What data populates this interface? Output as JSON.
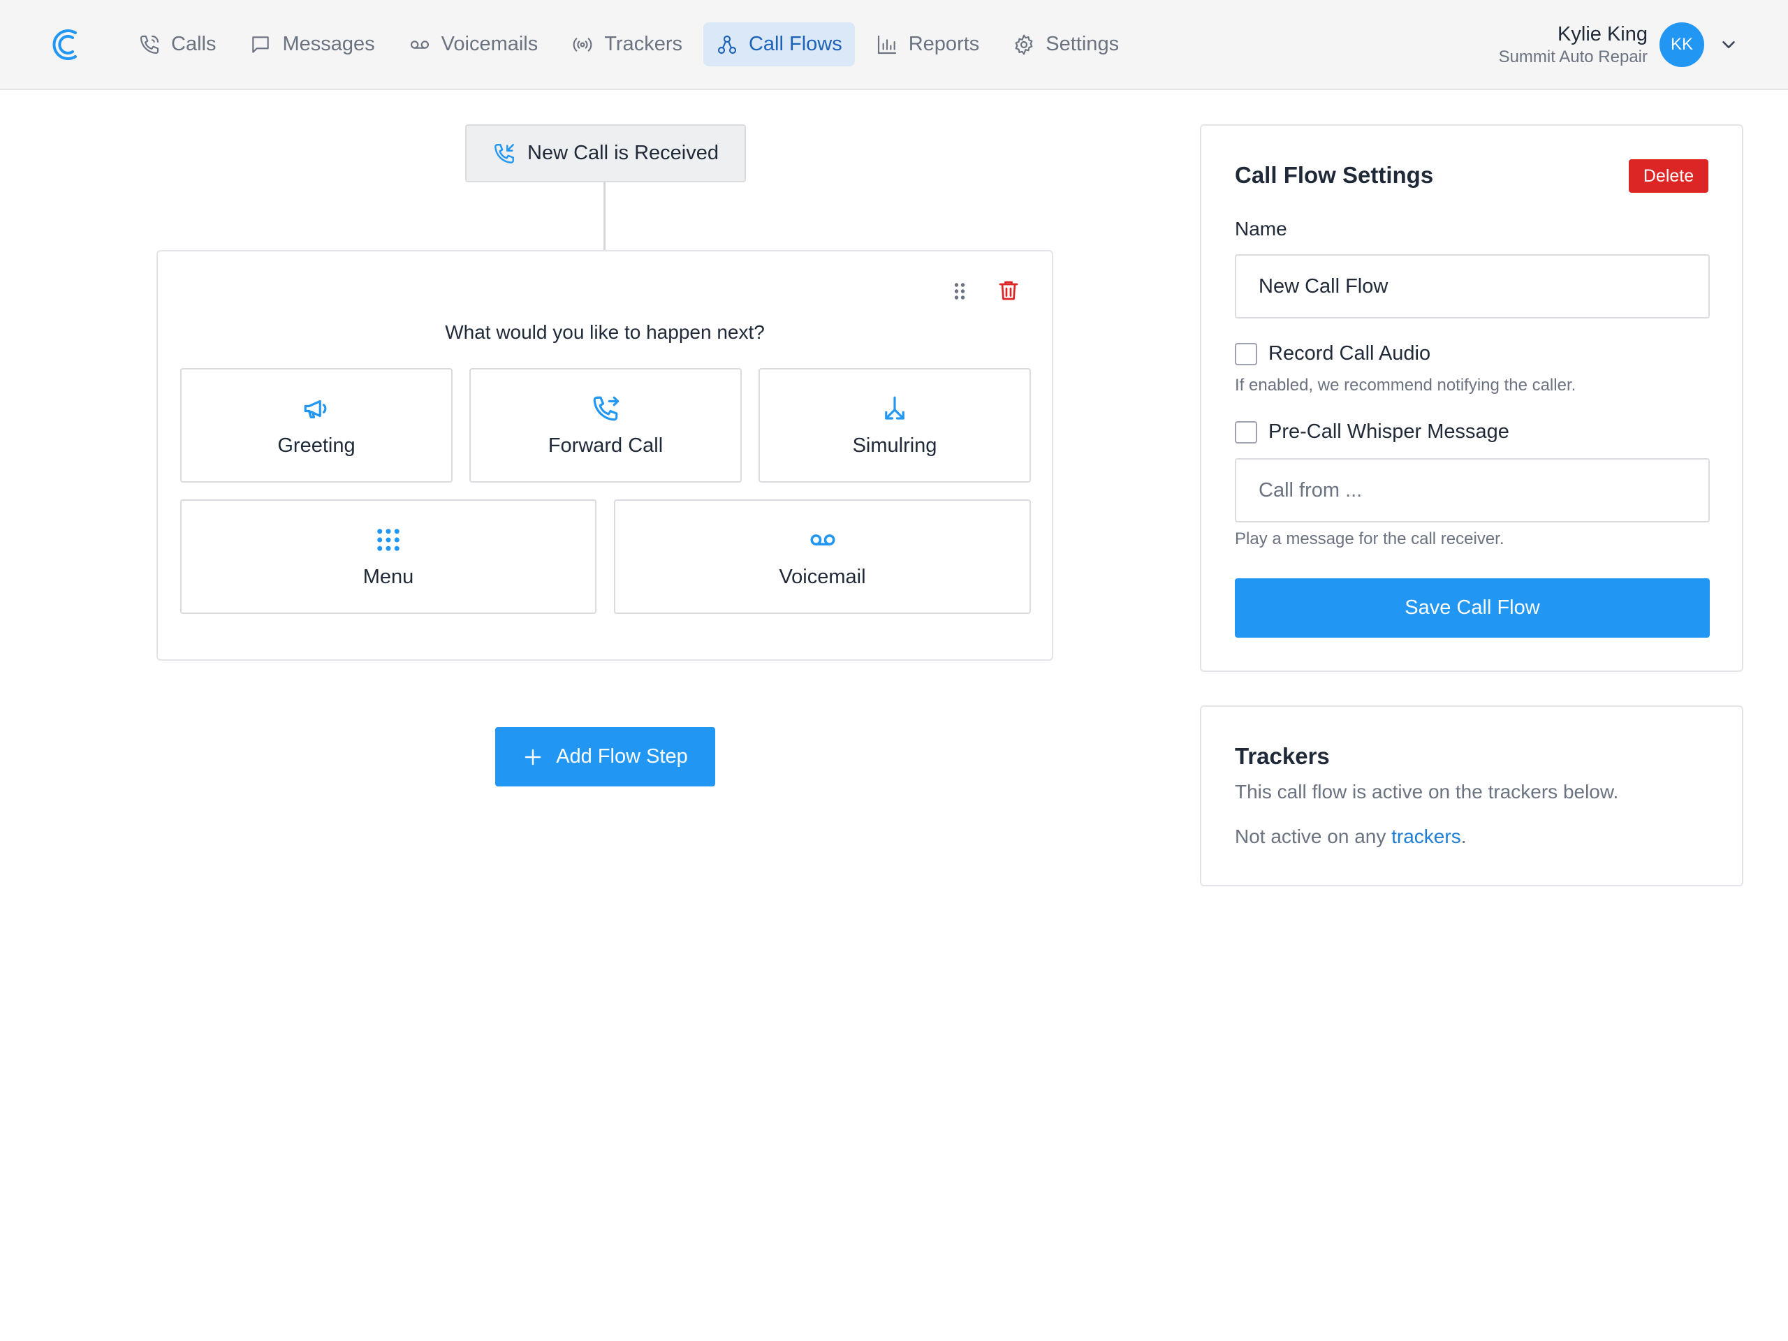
{
  "nav": {
    "items": [
      {
        "label": "Calls",
        "icon": "phone-icon"
      },
      {
        "label": "Messages",
        "icon": "message-icon"
      },
      {
        "label": "Voicemails",
        "icon": "voicemail-icon"
      },
      {
        "label": "Trackers",
        "icon": "broadcast-icon"
      },
      {
        "label": "Call Flows",
        "icon": "flow-icon",
        "active": true
      },
      {
        "label": "Reports",
        "icon": "bar-chart-icon"
      },
      {
        "label": "Settings",
        "icon": "gear-icon"
      }
    ]
  },
  "user": {
    "name": "Kylie King",
    "organization": "Summit Auto Repair",
    "initials": "KK"
  },
  "flow": {
    "trigger_label": "New Call is Received",
    "step": {
      "question": "What would you like to happen next?",
      "options": [
        {
          "label": "Greeting",
          "icon": "megaphone-icon"
        },
        {
          "label": "Forward Call",
          "icon": "phone-forward-icon"
        },
        {
          "label": "Simulring",
          "icon": "split-arrows-icon"
        },
        {
          "label": "Menu",
          "icon": "keypad-icon"
        },
        {
          "label": "Voicemail",
          "icon": "voicemail-icon"
        }
      ]
    },
    "add_step_label": "Add Flow Step"
  },
  "settings_panel": {
    "title": "Call Flow Settings",
    "delete_label": "Delete",
    "name_label": "Name",
    "name_value": "New Call Flow",
    "record_audio_label": "Record Call Audio",
    "record_audio_checked": false,
    "record_audio_hint": "If enabled, we recommend notifying the caller.",
    "whisper_label": "Pre-Call Whisper Message",
    "whisper_checked": false,
    "whisper_placeholder": "Call from ...",
    "whisper_hint": "Play a message for the call receiver.",
    "save_label": "Save Call Flow"
  },
  "trackers_panel": {
    "title": "Trackers",
    "description": "This call flow is active on the trackers below.",
    "note_prefix": "Not active on any ",
    "note_link": "trackers",
    "note_suffix": "."
  },
  "colors": {
    "accent": "#2196f3",
    "nav_active_bg": "#dbe8f7",
    "nav_active_text": "#1c63b8",
    "danger": "#dc2626",
    "topbar_bg": "#f5f5f6"
  }
}
